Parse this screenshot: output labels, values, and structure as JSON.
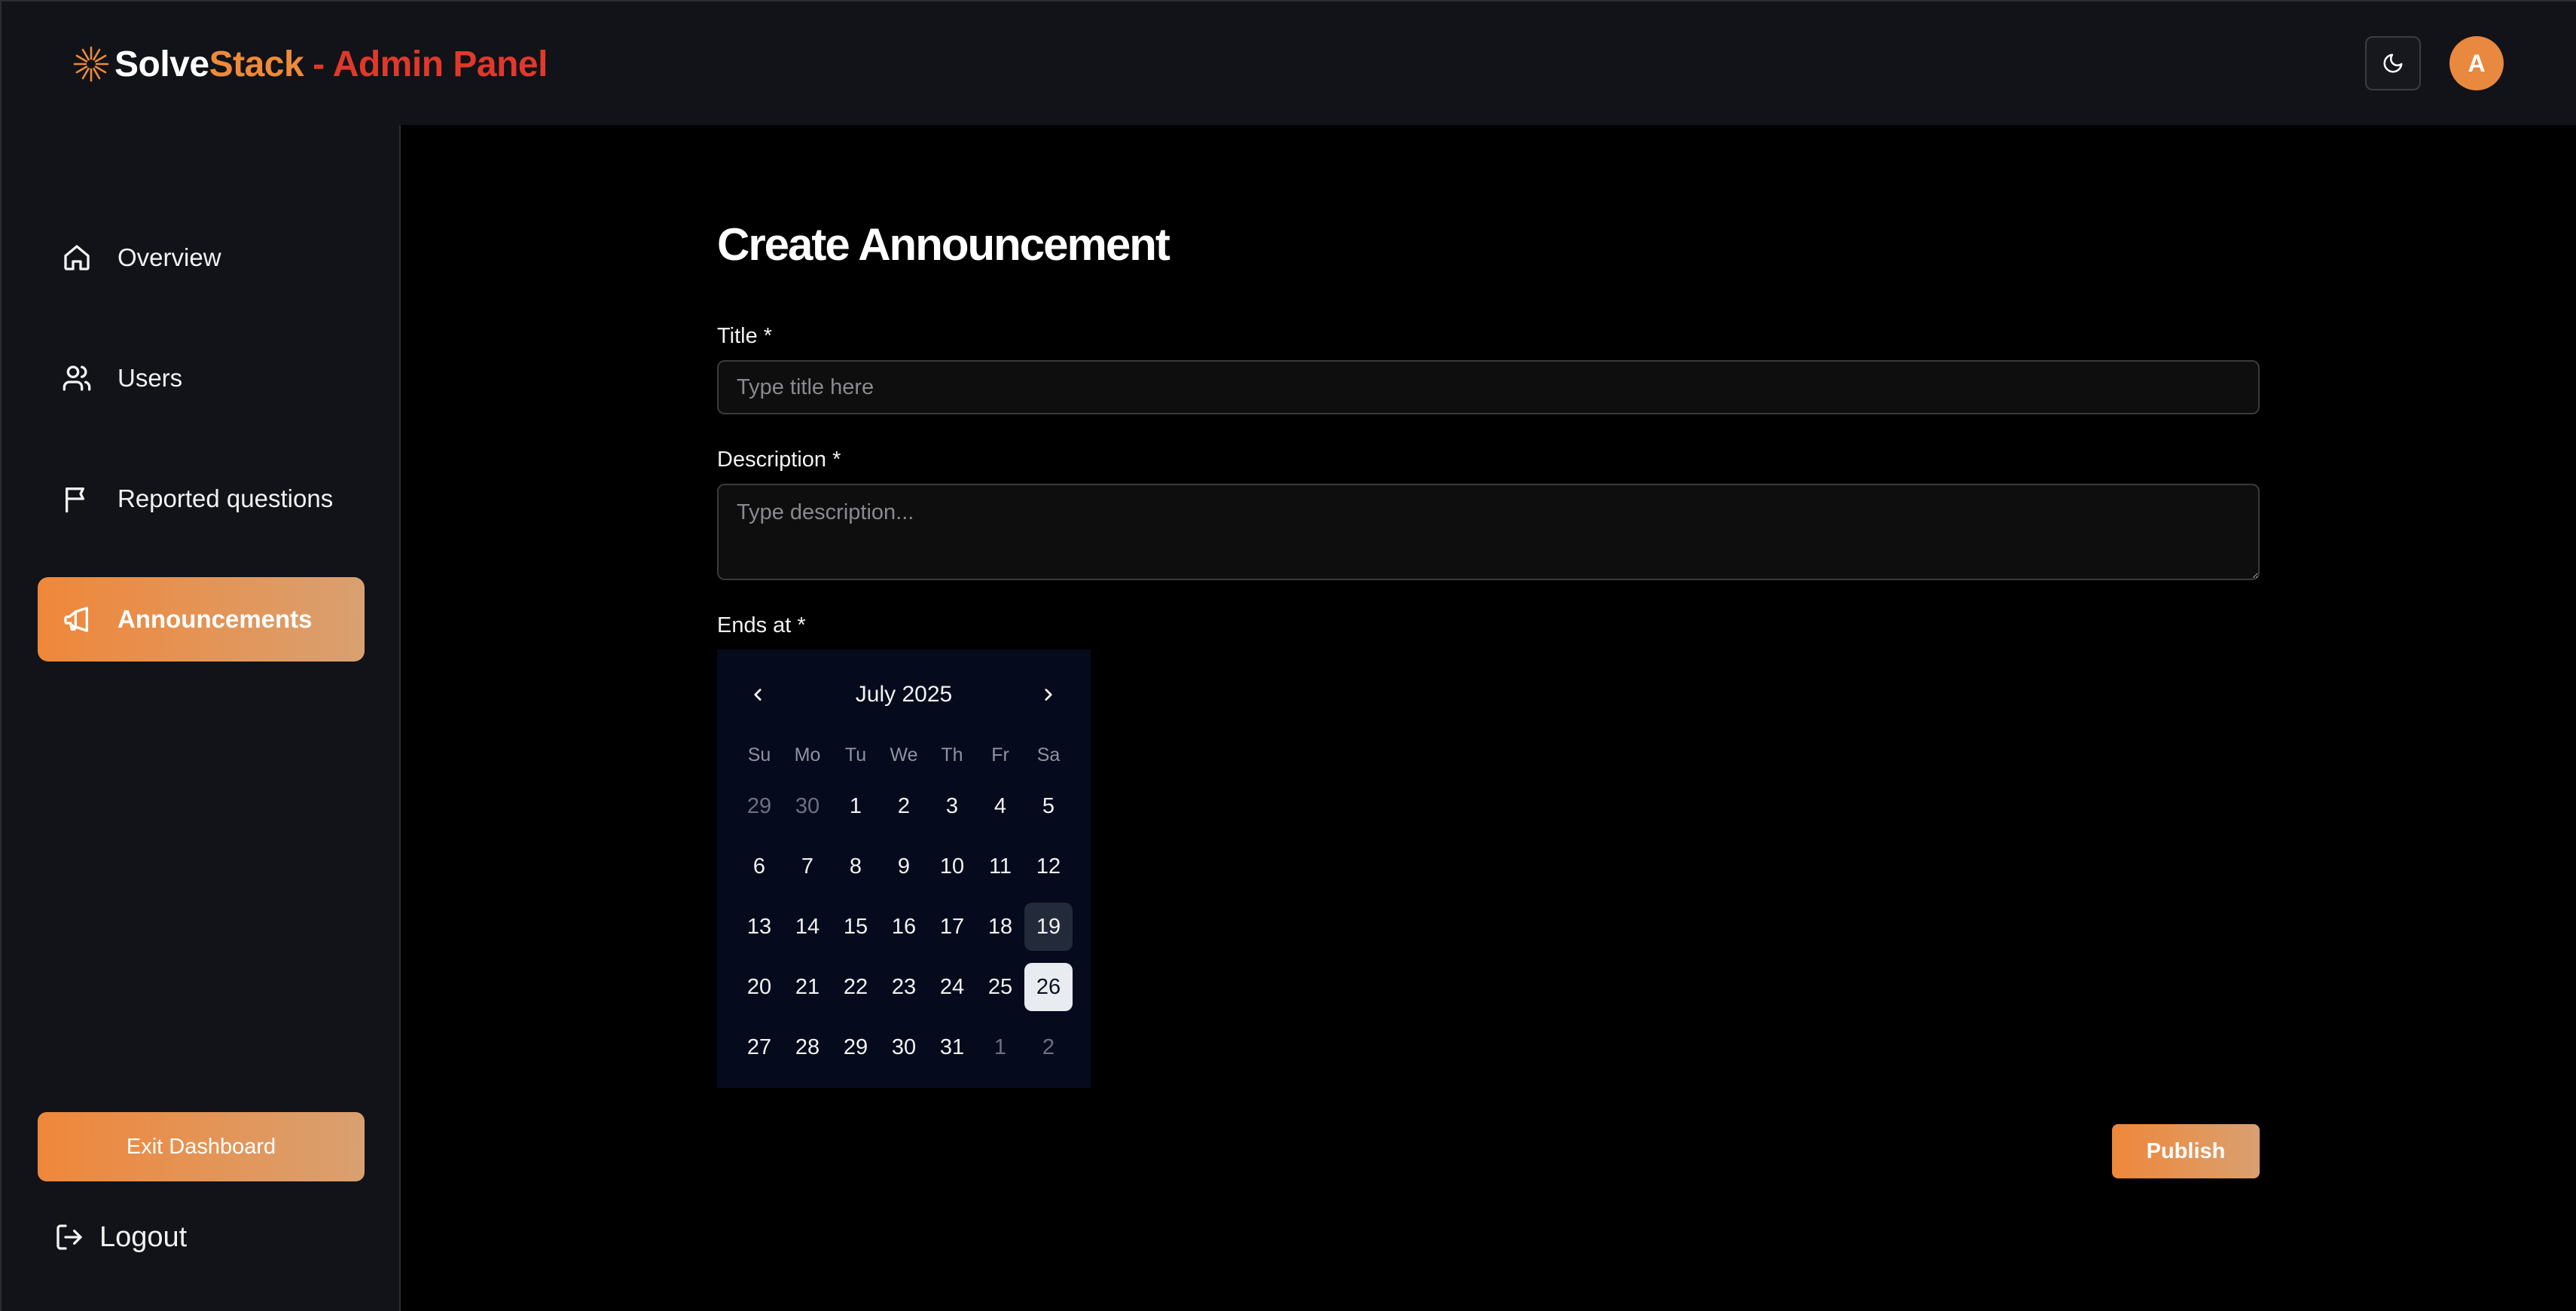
{
  "header": {
    "logo_solve": "Solve",
    "logo_stack": "Stack",
    "logo_admin": "- Admin Panel",
    "avatar_initial": "A"
  },
  "sidebar": {
    "items": [
      {
        "label": "Overview",
        "icon": "home-icon"
      },
      {
        "label": "Users",
        "icon": "users-icon"
      },
      {
        "label": "Reported questions",
        "icon": "flag-icon"
      },
      {
        "label": "Announcements",
        "icon": "megaphone-icon",
        "active": true
      }
    ],
    "exit_label": "Exit Dashboard",
    "logout_label": "Logout"
  },
  "form": {
    "title": "Create Announcement",
    "title_label": "Title *",
    "title_placeholder": "Type title here",
    "description_label": "Description *",
    "description_placeholder": "Type description...",
    "ends_label": "Ends at *",
    "publish_label": "Publish"
  },
  "calendar": {
    "month_label": "July 2025",
    "weekdays": [
      "Su",
      "Mo",
      "Tu",
      "We",
      "Th",
      "Fr",
      "Sa"
    ],
    "weeks": [
      [
        "29",
        "30",
        "1",
        "2",
        "3",
        "4",
        "5"
      ],
      [
        "6",
        "7",
        "8",
        "9",
        "10",
        "11",
        "12"
      ],
      [
        "13",
        "14",
        "15",
        "16",
        "17",
        "18",
        "19"
      ],
      [
        "20",
        "21",
        "22",
        "23",
        "24",
        "25",
        "26"
      ],
      [
        "27",
        "28",
        "29",
        "30",
        "31",
        "1",
        "2"
      ]
    ],
    "today": "19",
    "selected": "26"
  },
  "colors": {
    "accent": "#ef873a",
    "admin_red": "#e0392b"
  }
}
